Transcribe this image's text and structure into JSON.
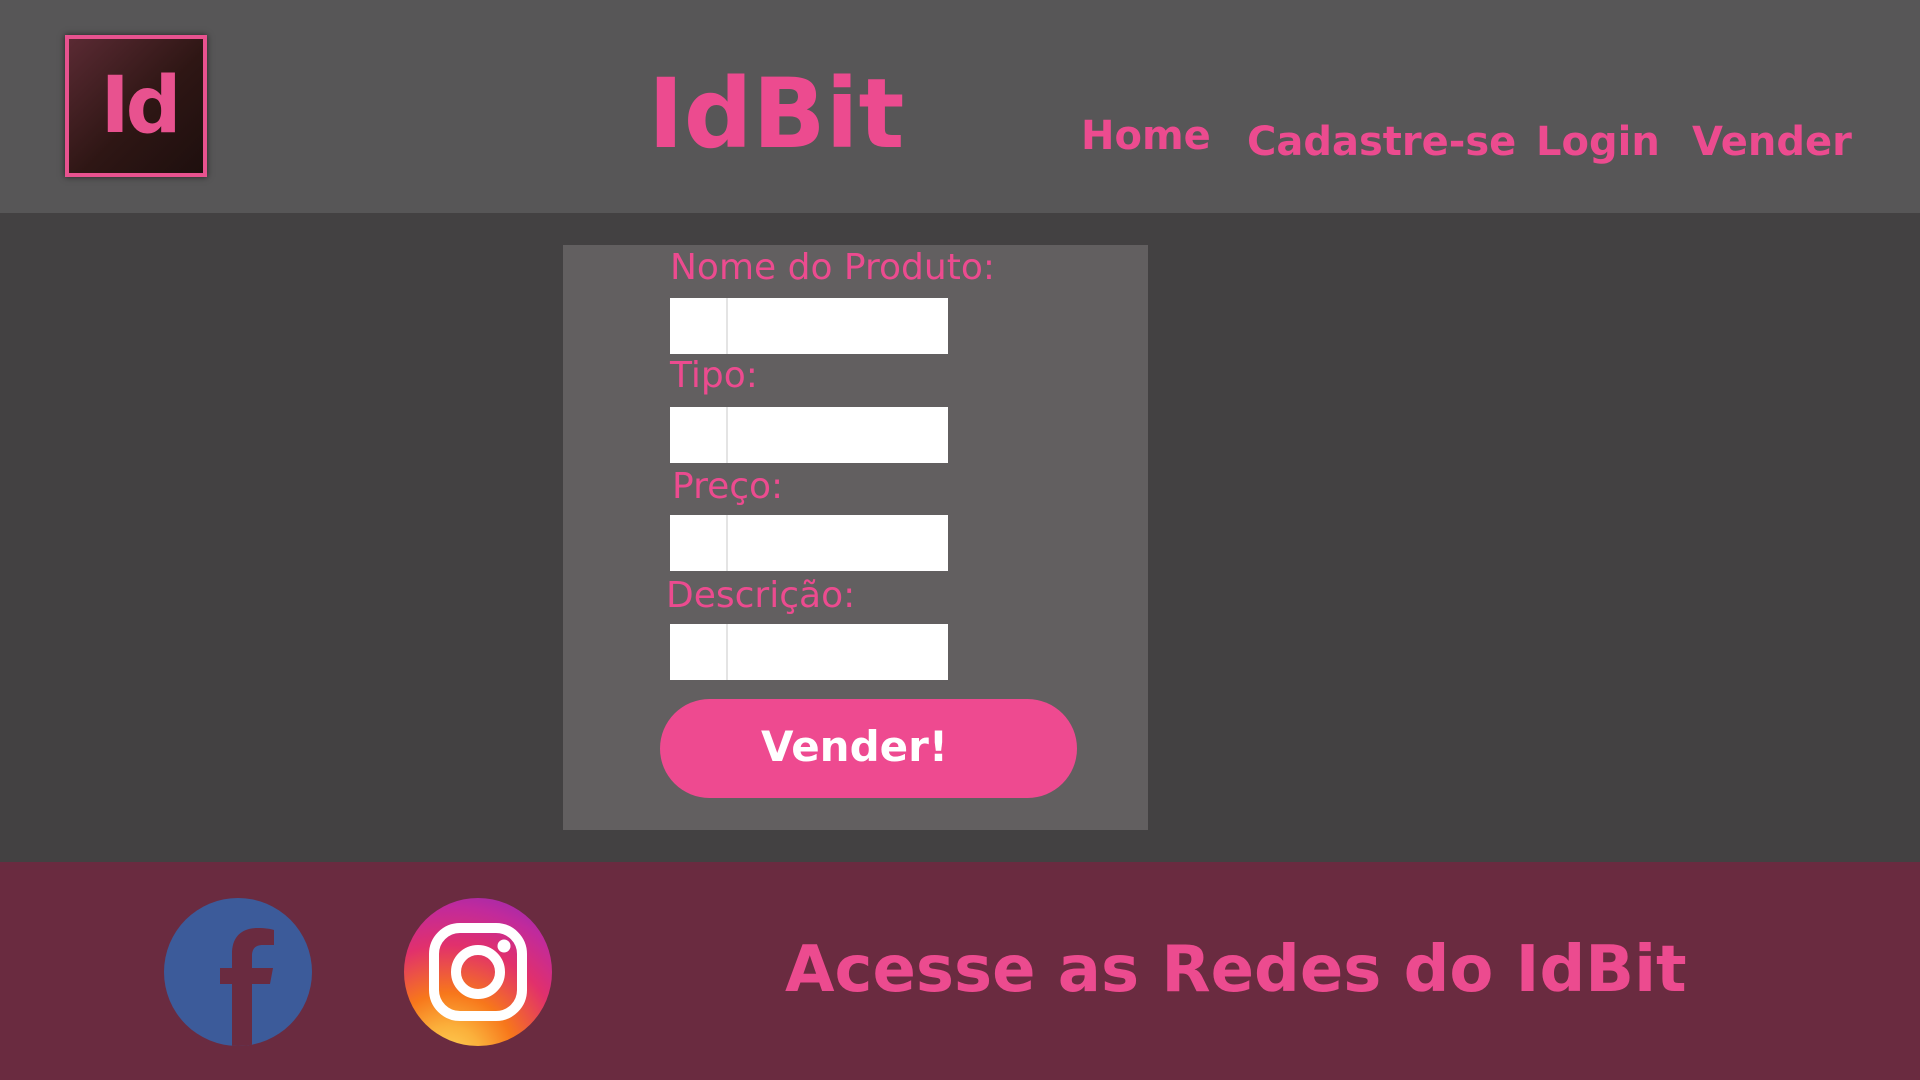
{
  "header": {
    "logo_text": "Id",
    "brand": "IdBit",
    "nav": [
      {
        "label": "Home"
      },
      {
        "label": "Cadastre-se"
      },
      {
        "label": "Login"
      },
      {
        "label": "Vender"
      }
    ]
  },
  "form": {
    "fields": [
      {
        "label": "Nome do Produto:",
        "value": "",
        "placeholder": ""
      },
      {
        "label": "Tipo:",
        "value": "",
        "placeholder": ""
      },
      {
        "label": "Preço:",
        "value": "",
        "placeholder": ""
      },
      {
        "label": "Descrição:",
        "value": "",
        "placeholder": ""
      }
    ],
    "submit_label": "Vender!"
  },
  "footer": {
    "social": [
      {
        "icon": "facebook-icon"
      },
      {
        "icon": "instagram-icon"
      }
    ],
    "text": "Acesse as Redes do IdBit"
  },
  "colors": {
    "accent": "#ec4b8f",
    "header_bg": "#575657",
    "body_bg": "#434142",
    "panel_bg": "#625f60",
    "footer_bg": "#6a2b40"
  }
}
